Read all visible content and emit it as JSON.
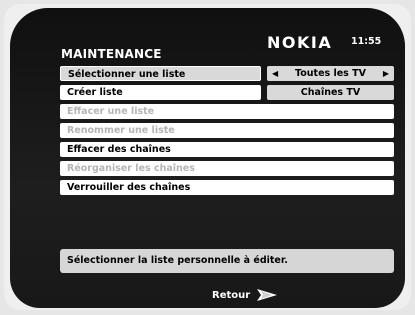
{
  "header": {
    "title": "MAINTENANCE",
    "brand": "NOKIA",
    "clock": "11:55"
  },
  "menu": {
    "items": [
      {
        "label": "Sélectionner une liste",
        "state": "selected"
      },
      {
        "label": "Créer liste",
        "state": "enabled"
      },
      {
        "label": "Effacer une liste",
        "state": "disabled"
      },
      {
        "label": "Renommer une liste",
        "state": "disabled"
      },
      {
        "label": "Effacer des chaînes",
        "state": "enabled"
      },
      {
        "label": "Réorganiser les chaînes",
        "state": "disabled"
      },
      {
        "label": "Verrouiller des chaînes",
        "state": "enabled"
      }
    ],
    "selector": {
      "value": "Toutes les TV",
      "left_arrow": "◀",
      "right_arrow": "▶"
    },
    "option_below": "Chaînes TV"
  },
  "help_text": "Sélectionner la liste personnelle à éditer.",
  "footer": {
    "back_label": "Retour",
    "back_icon": "arrow-right-icon"
  },
  "colors": {
    "screen_bg": "#141414",
    "row_bg": "#ffffff",
    "disabled_text": "#b4b4b4",
    "highlight_bg": "#d9d9d9"
  }
}
